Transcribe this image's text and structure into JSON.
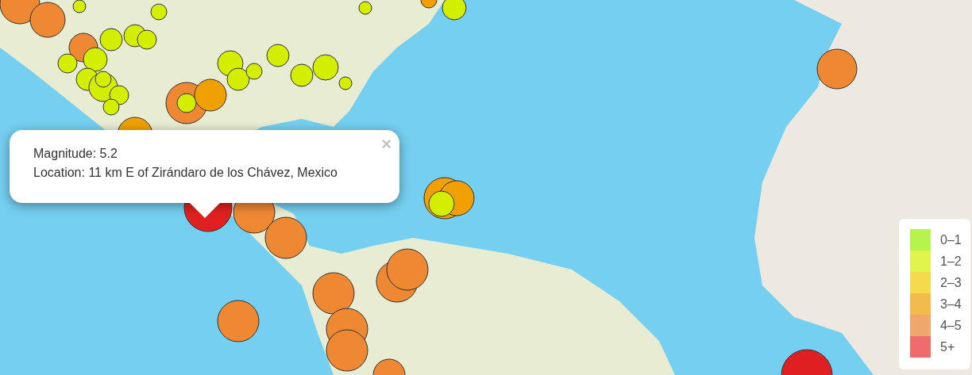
{
  "popup": {
    "lines": [
      "Magnitude: 5.2",
      "Location: 11 km E of Zirándaro de los Chávez, Mexico"
    ],
    "close": "×"
  },
  "legend": {
    "items": [
      {
        "label": "0–1",
        "color": "#b7f34d"
      },
      {
        "label": "1–2",
        "color": "#e1f34d"
      },
      {
        "label": "2–3",
        "color": "#f3db4d"
      },
      {
        "label": "3–4",
        "color": "#f3ba4d"
      },
      {
        "label": "4–5",
        "color": "#f0a76b"
      },
      {
        "label": "5+",
        "color": "#f06b6b"
      }
    ]
  }
}
